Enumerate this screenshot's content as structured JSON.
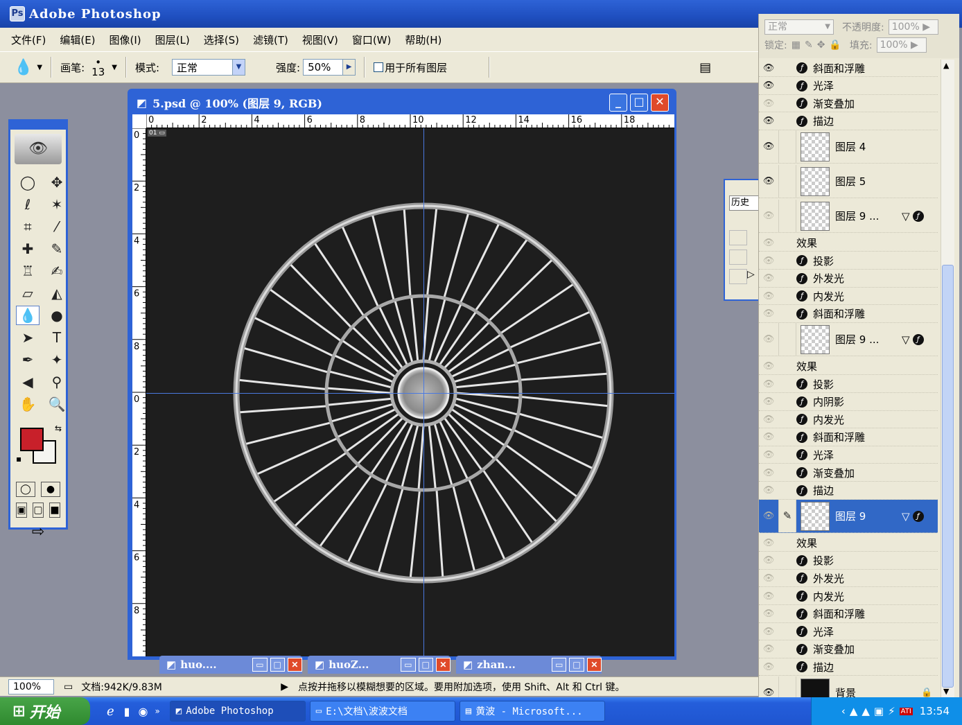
{
  "app": {
    "title": "Adobe Photoshop"
  },
  "menu": [
    "文件(F)",
    "编辑(E)",
    "图像(I)",
    "图层(L)",
    "选择(S)",
    "滤镜(T)",
    "视图(V)",
    "窗口(W)",
    "帮助(H)"
  ],
  "options": {
    "brush_label": "画笔:",
    "brush_size": "13",
    "mode_label": "模式:",
    "mode_value": "正常",
    "strength_label": "强度:",
    "strength_value": "50%",
    "all_layers_label": "用于所有图层"
  },
  "document": {
    "title": "5.psd @ 100% (图层 9, RGB)",
    "ruler_top": [
      "0",
      "2",
      "4",
      "6",
      "8",
      "10",
      "12",
      "14",
      "16",
      "18"
    ],
    "ruler_left": [
      "0",
      "2",
      "4",
      "6",
      "8",
      "0",
      "2",
      "4",
      "6",
      "8"
    ]
  },
  "minimized_docs": [
    "huo....",
    "huoZ...",
    "zhan..."
  ],
  "layers_panel": {
    "blend_mode": "正常",
    "opacity_label": "不透明度:",
    "opacity_value": "100%",
    "lock_label": "锁定:",
    "fill_label": "填充:",
    "fill_value": "100%",
    "rows": [
      {
        "type": "effect",
        "label": "斜面和浮雕",
        "eye": true
      },
      {
        "type": "effect",
        "label": "光泽",
        "eye": true
      },
      {
        "type": "effect",
        "label": "渐变叠加",
        "eye": false
      },
      {
        "type": "effect",
        "label": "描边",
        "eye": true
      },
      {
        "type": "layer",
        "label": "图层 4",
        "eye": true
      },
      {
        "type": "layer",
        "label": "图层 5",
        "eye": true
      },
      {
        "type": "layer",
        "label": "图层 9 ...",
        "eye": false,
        "fx": true
      },
      {
        "type": "effects-header",
        "label": "效果",
        "eye": false
      },
      {
        "type": "effect",
        "label": "投影",
        "eye": false
      },
      {
        "type": "effect",
        "label": "外发光",
        "eye": false
      },
      {
        "type": "effect",
        "label": "内发光",
        "eye": false
      },
      {
        "type": "effect",
        "label": "斜面和浮雕",
        "eye": false
      },
      {
        "type": "layer",
        "label": "图层 9 ...",
        "eye": false,
        "fx": true
      },
      {
        "type": "effects-header",
        "label": "效果",
        "eye": false
      },
      {
        "type": "effect",
        "label": "投影",
        "eye": false
      },
      {
        "type": "effect",
        "label": "内阴影",
        "eye": false
      },
      {
        "type": "effect",
        "label": "内发光",
        "eye": false
      },
      {
        "type": "effect",
        "label": "斜面和浮雕",
        "eye": false
      },
      {
        "type": "effect",
        "label": "光泽",
        "eye": false
      },
      {
        "type": "effect",
        "label": "渐变叠加",
        "eye": false
      },
      {
        "type": "effect",
        "label": "描边",
        "eye": false
      },
      {
        "type": "layer",
        "label": "图层 9",
        "eye": false,
        "fx": true,
        "selected": true
      },
      {
        "type": "effects-header",
        "label": "效果",
        "eye": false
      },
      {
        "type": "effect",
        "label": "投影",
        "eye": false
      },
      {
        "type": "effect",
        "label": "外发光",
        "eye": false
      },
      {
        "type": "effect",
        "label": "内发光",
        "eye": false
      },
      {
        "type": "effect",
        "label": "斜面和浮雕",
        "eye": false
      },
      {
        "type": "effect",
        "label": "光泽",
        "eye": false
      },
      {
        "type": "effect",
        "label": "渐变叠加",
        "eye": false
      },
      {
        "type": "effect",
        "label": "描边",
        "eye": false
      },
      {
        "type": "layer",
        "label": "背景",
        "eye": true,
        "locked": true,
        "dark": true
      }
    ]
  },
  "history_panel": {
    "tab": "历史"
  },
  "status": {
    "zoom": "100%",
    "doc_size": "文档:942K/9.83M",
    "hint": "点按并拖移以模糊想要的区域。要用附加选项，使用 Shift、Alt 和 Ctrl 键。"
  },
  "taskbar": {
    "start": "开始",
    "tasks": [
      "Adobe Photoshop",
      "E:\\文档\\波波文档",
      "黄波 - Microsoft..."
    ],
    "clock": "13:54"
  },
  "colors": {
    "foreground": "#c8202a",
    "background": "#f5f5f0",
    "accent": "#2e63d6"
  }
}
